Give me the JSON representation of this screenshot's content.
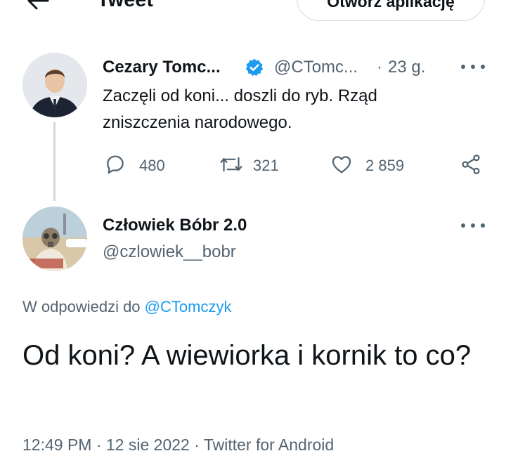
{
  "header": {
    "title": "Tweet",
    "open_app_label": "Otwórz aplikację"
  },
  "parent_tweet": {
    "author_name": "Cezary Tomc...",
    "verified": true,
    "handle": "@CTomc...",
    "separator": "·",
    "time_ago": "23 g.",
    "text": "Zaczęli od koni... doszli do ryb. Rząd zniszczenia narodowego.",
    "replies": "480",
    "retweets": "321",
    "likes": "2 859"
  },
  "main_tweet": {
    "author_name": "Człowiek Bóbr 2.0",
    "handle": "@czlowiek__bobr",
    "reply_to_prefix": "W odpowiedzi do",
    "reply_to_mention": "@CTomczyk",
    "text": "Od koni? A wiewiorka i kornik to co?",
    "timestamp": "12:49 PM · 12 sie 2022 · Twitter for Android"
  },
  "colors": {
    "accent": "#1d9bf0",
    "secondary_text": "#536471",
    "primary_text": "#0f1419",
    "border": "#cfd9de"
  },
  "icons": [
    "back-arrow-icon",
    "verified-badge-icon",
    "more-icon",
    "reply-icon",
    "retweet-icon",
    "like-icon",
    "share-icon"
  ]
}
